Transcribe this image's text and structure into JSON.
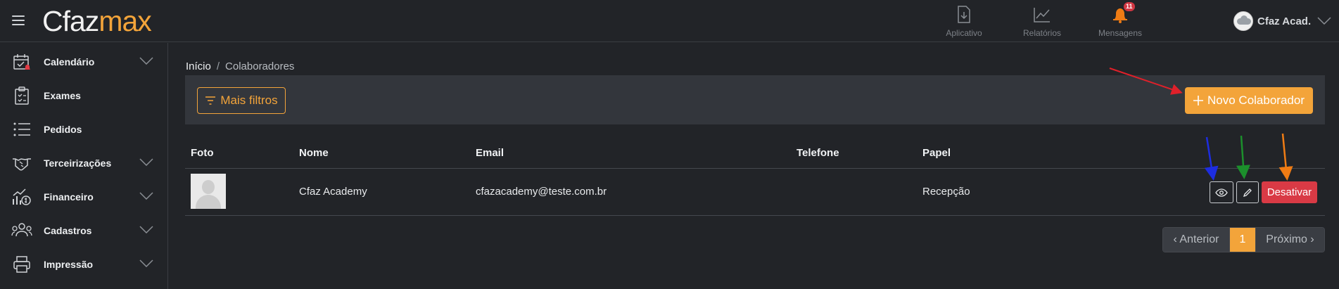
{
  "header": {
    "logo_part1": "Cfaz",
    "logo_part2": "max",
    "nav": [
      {
        "label": "Aplicativo",
        "icon": "download-file-icon"
      },
      {
        "label": "Relatórios",
        "icon": "chart-trend-icon"
      },
      {
        "label": "Mensagens",
        "icon": "bell-icon",
        "badge": "11"
      }
    ],
    "user_name": "Cfaz Acad.",
    "colors": {
      "brand": "#f3a43a",
      "badge": "#d23743"
    }
  },
  "sidebar": {
    "items": [
      {
        "label": "Calendário",
        "icon": "calendar-icon",
        "expandable": true
      },
      {
        "label": "Exames",
        "icon": "clipboard-icon",
        "expandable": false
      },
      {
        "label": "Pedidos",
        "icon": "list-icon",
        "expandable": false
      },
      {
        "label": "Terceirizações",
        "icon": "handshake-icon",
        "expandable": true
      },
      {
        "label": "Financeiro",
        "icon": "finance-chart-icon",
        "expandable": true
      },
      {
        "label": "Cadastros",
        "icon": "users-icon",
        "expandable": true
      },
      {
        "label": "Impressão",
        "icon": "printer-icon",
        "expandable": true
      }
    ]
  },
  "breadcrumb": {
    "home": "Início",
    "separator": "/",
    "current": "Colaboradores"
  },
  "toolbar": {
    "filter_label": "Mais filtros",
    "new_label": "Novo Colaborador"
  },
  "table": {
    "columns": [
      "Foto",
      "Nome",
      "Email",
      "Telefone",
      "Papel"
    ],
    "rows": [
      {
        "name": "Cfaz Academy",
        "email": "cfazacademy@teste.com.br",
        "phone": "",
        "role": "Recepção",
        "deactivate_label": "Desativar"
      }
    ]
  },
  "pagination": {
    "prev": "‹ Anterior",
    "current": "1",
    "next": "Próximo ›"
  },
  "annotation_arrows": {
    "colors": [
      "#e0202a",
      "#1d2de0",
      "#1c8f2c",
      "#f07c14"
    ]
  }
}
